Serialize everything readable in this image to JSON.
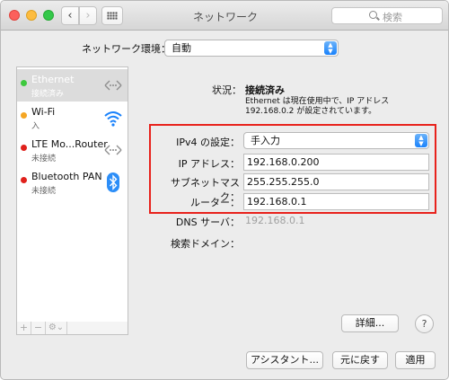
{
  "window": {
    "title": "ネットワーク",
    "search_placeholder": "検索"
  },
  "toolbar": {
    "back_glyph": "‹",
    "forward_glyph": "›"
  },
  "location": {
    "label": "ネットワーク環境：",
    "value": "自動"
  },
  "services": [
    {
      "name": "Ethernet",
      "status": "接続済み",
      "dot_color": "#3ec93e",
      "icon": "ethernet-arrows-icon",
      "selected": true
    },
    {
      "name": "Wi-Fi",
      "status": "入",
      "dot_color": "#f5a623",
      "icon": "wifi-icon",
      "selected": false
    },
    {
      "name": "LTE Mo...Router",
      "status": "未接続",
      "dot_color": "#e0211c",
      "icon": "ethernet-arrows-icon",
      "selected": false
    },
    {
      "name": "Bluetooth PAN",
      "status": "未接続",
      "dot_color": "#e0211c",
      "icon": "bluetooth-icon",
      "selected": false
    }
  ],
  "sidebar_toolbar": {
    "add": "+",
    "remove": "−",
    "gear": "⚙︎⌄"
  },
  "detail": {
    "status_label": "状況：",
    "status_value": "接続済み",
    "status_desc": "Ethernet は現在使用中で、IP アドレス 192.168.0.2 が設定されています。",
    "ipv4_label": "IPv4 の設定：",
    "ipv4_value": "手入力",
    "ip_label": "IP アドレス：",
    "ip_value": "192.168.0.200",
    "mask_label": "サブネットマスク：",
    "mask_value": "255.255.255.0",
    "router_label": "ルーター：",
    "router_value": "192.168.0.1",
    "dns_label": "DNS サーバ：",
    "dns_value": "192.168.0.1",
    "domain_label": "検索ドメイン："
  },
  "buttons": {
    "advanced": "詳細...",
    "help": "?",
    "assistant": "アシスタント...",
    "revert": "元に戻す",
    "apply": "適用"
  },
  "colors": {
    "highlight_box": "#e8221c",
    "popup_accent": "#1a82fb",
    "wifi_blue": "#1a82fb"
  }
}
